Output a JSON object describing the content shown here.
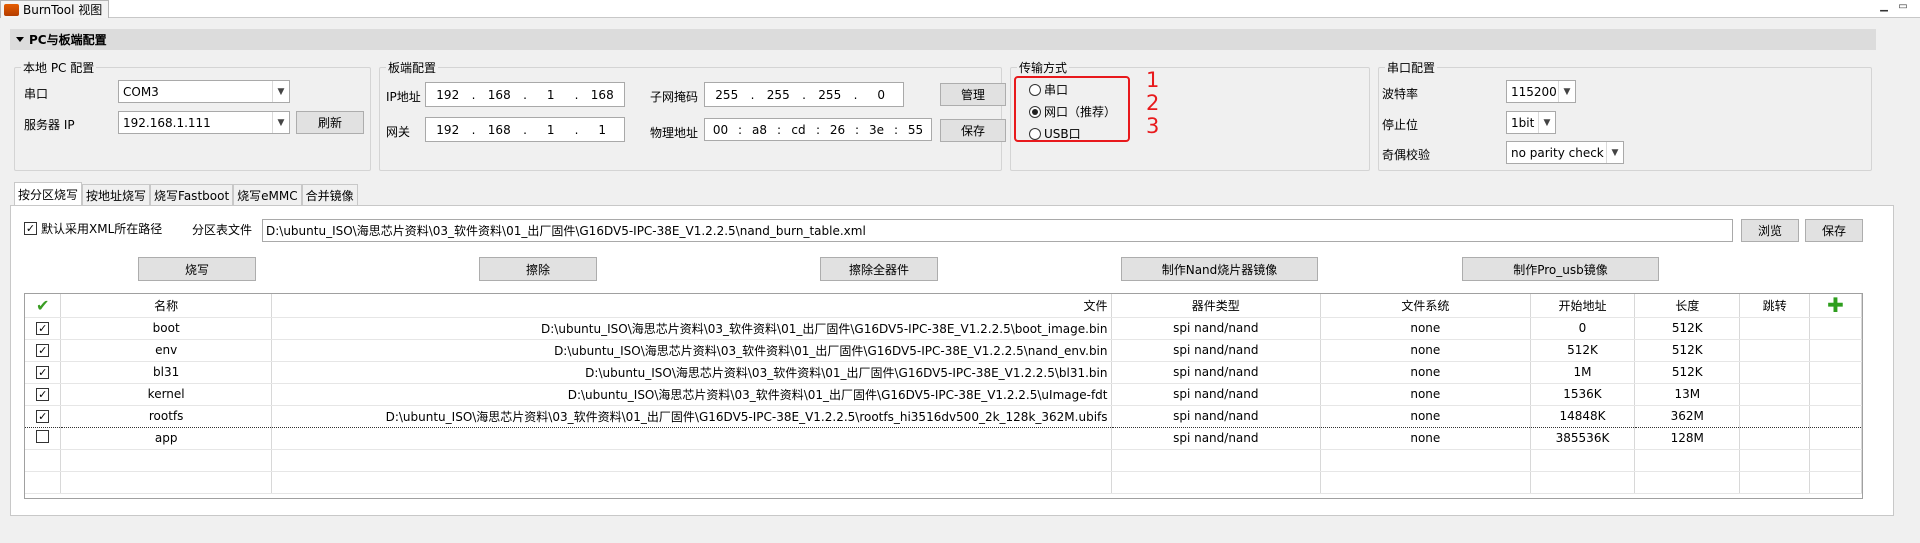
{
  "window": {
    "title": "BurnTool 视图"
  },
  "section": {
    "title": "PC与板端配置"
  },
  "pc_config": {
    "legend": "本地 PC 配置",
    "port_label": "串口",
    "port_value": "COM3",
    "server_ip_label": "服务器 IP",
    "server_ip_value": "192.168.1.111",
    "refresh_label": "刷新"
  },
  "board_config": {
    "legend": "板端配置",
    "ip_label": "IP地址",
    "ip": [
      "192",
      "168",
      "1",
      "168"
    ],
    "gateway_label": "网关",
    "gateway": [
      "192",
      "168",
      "1",
      "1"
    ],
    "mask_label": "子网掩码",
    "mask": [
      "255",
      "255",
      "255",
      "0"
    ],
    "mac_label": "物理地址",
    "mac": [
      "00",
      "a8",
      "cd",
      "26",
      "3e",
      "55"
    ],
    "manage_label": "管理",
    "save_label": "保存"
  },
  "transfer": {
    "legend": "传输方式",
    "options": [
      "串口",
      "网口（推荐）",
      "USB口"
    ],
    "selected": 1,
    "annotations": [
      "1",
      "2",
      "3"
    ],
    "annotation_color": "#e8191c"
  },
  "serial_config": {
    "legend": "串口配置",
    "baud_label": "波特率",
    "baud_value": "115200",
    "stop_label": "停止位",
    "stop_value": "1bit",
    "parity_label": "奇偶校验",
    "parity_value": "no parity check"
  },
  "tabs": [
    "按分区烧写",
    "按地址烧写",
    "烧写Fastboot",
    "烧写eMMC",
    "合并镜像"
  ],
  "partition_tab": {
    "default_xml_label": "默认采用XML所在路径",
    "table_file_label": "分区表文件",
    "table_file_path": "D:\\ubuntu_ISO\\海思芯片资料\\03_软件资料\\01_出厂固件\\G16DV5-IPC-38E_V1.2.2.5\\nand_burn_table.xml",
    "browse_label": "浏览",
    "save_label": "保存",
    "actions": [
      "烧写",
      "擦除",
      "擦除全器件",
      "制作Nand烧片器镜像",
      "制作Pro_usb镜像"
    ]
  },
  "grid": {
    "columns": [
      "名称",
      "文件",
      "器件类型",
      "文件系统",
      "开始地址",
      "长度",
      "跳转"
    ],
    "rows": [
      {
        "checked": true,
        "name": "boot",
        "file": "D:\\ubuntu_ISO\\海思芯片资料\\03_软件资料\\01_出厂固件\\G16DV5-IPC-38E_V1.2.2.5\\boot_image.bin",
        "device": "spi nand/nand",
        "fs": "none",
        "start": "0",
        "length": "512K"
      },
      {
        "checked": true,
        "name": "env",
        "file": "D:\\ubuntu_ISO\\海思芯片资料\\03_软件资料\\01_出厂固件\\G16DV5-IPC-38E_V1.2.2.5\\nand_env.bin",
        "device": "spi nand/nand",
        "fs": "none",
        "start": "512K",
        "length": "512K"
      },
      {
        "checked": true,
        "name": "bl31",
        "file": "D:\\ubuntu_ISO\\海思芯片资料\\03_软件资料\\01_出厂固件\\G16DV5-IPC-38E_V1.2.2.5\\bl31.bin",
        "device": "spi nand/nand",
        "fs": "none",
        "start": "1M",
        "length": "512K"
      },
      {
        "checked": true,
        "name": "kernel",
        "file": "D:\\ubuntu_ISO\\海思芯片资料\\03_软件资料\\01_出厂固件\\G16DV5-IPC-38E_V1.2.2.5\\uImage-fdt",
        "device": "spi nand/nand",
        "fs": "none",
        "start": "1536K",
        "length": "13M"
      },
      {
        "checked": true,
        "name": "rootfs",
        "file": "D:\\ubuntu_ISO\\海思芯片资料\\03_软件资料\\01_出厂固件\\G16DV5-IPC-38E_V1.2.2.5\\rootfs_hi3516dv500_2k_128k_362M.ubifs",
        "device": "spi nand/nand",
        "fs": "none",
        "start": "14848K",
        "length": "362M"
      },
      {
        "checked": false,
        "name": "app",
        "file": "",
        "device": "spi nand/nand",
        "fs": "none",
        "start": "385536K",
        "length": "128M"
      }
    ]
  }
}
